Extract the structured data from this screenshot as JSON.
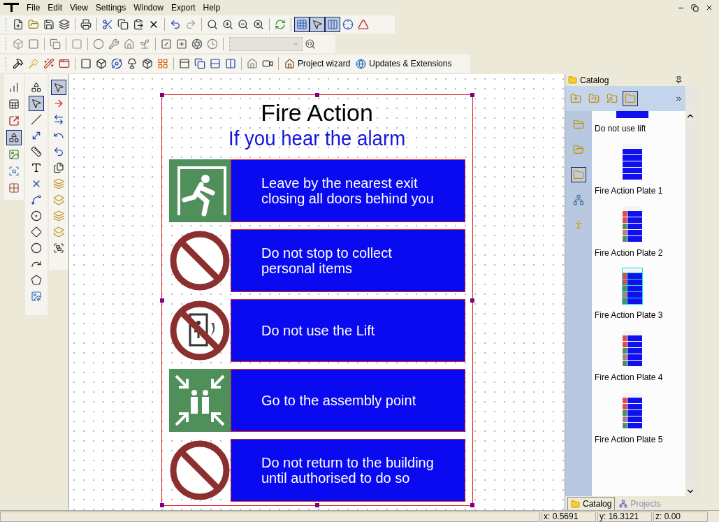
{
  "menu": [
    "File",
    "Edit",
    "View",
    "Settings",
    "Window",
    "Export",
    "Help"
  ],
  "toolbar_links": [
    {
      "label": "Project wizard"
    },
    {
      "label": "Updates & Extensions"
    }
  ],
  "sign": {
    "title": "Fire Action",
    "subtitle": "If you hear the alarm",
    "rows": [
      {
        "kind": "exit",
        "lines": [
          "Leave by the nearest exit",
          "closing all doors behind you"
        ]
      },
      {
        "kind": "prohibited",
        "lines": [
          "Do not stop to collect",
          "personal items"
        ]
      },
      {
        "kind": "no-lift",
        "lines": [
          "Do not use the Lift"
        ]
      },
      {
        "kind": "assembly",
        "lines": [
          "Go to the assembly point"
        ]
      },
      {
        "kind": "prohibited",
        "lines": [
          "Do not return to the building",
          "until authorised to do so"
        ]
      }
    ]
  },
  "catalog": {
    "title": "Catalog",
    "items": [
      {
        "label": "Do not use lift",
        "kind": "partial"
      },
      {
        "label": "Fire Action Plate 1",
        "kind": "plain",
        "color": "#ffffff"
      },
      {
        "label": "Fire Action Plate 2",
        "kind": "icons",
        "color": "#ffffff"
      },
      {
        "label": "Fire Action Plate 3",
        "kind": "icons",
        "color": "#22e0e8"
      },
      {
        "label": "Fire Action Plate 4",
        "kind": "icons",
        "color": "#ffffff"
      },
      {
        "label": "Fire Action Plate 5",
        "kind": "icons",
        "color": "#ffffff"
      }
    ],
    "tabs": [
      {
        "label": "Catalog",
        "selected": true
      },
      {
        "label": "Projects",
        "selected": false
      }
    ]
  },
  "status": [
    "x: 0.5691",
    "y: 16.3121",
    "z: 0.00"
  ]
}
